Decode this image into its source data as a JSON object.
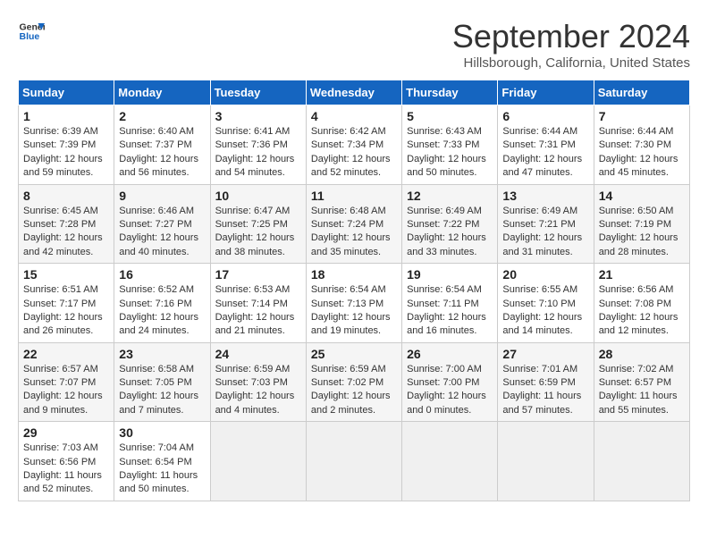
{
  "logo": {
    "line1": "General",
    "line2": "Blue"
  },
  "title": "September 2024",
  "subtitle": "Hillsborough, California, United States",
  "weekdays": [
    "Sunday",
    "Monday",
    "Tuesday",
    "Wednesday",
    "Thursday",
    "Friday",
    "Saturday"
  ],
  "weeks": [
    [
      {
        "day": "1",
        "sunrise": "6:39 AM",
        "sunset": "7:39 PM",
        "daylight": "12 hours and 59 minutes."
      },
      {
        "day": "2",
        "sunrise": "6:40 AM",
        "sunset": "7:37 PM",
        "daylight": "12 hours and 56 minutes."
      },
      {
        "day": "3",
        "sunrise": "6:41 AM",
        "sunset": "7:36 PM",
        "daylight": "12 hours and 54 minutes."
      },
      {
        "day": "4",
        "sunrise": "6:42 AM",
        "sunset": "7:34 PM",
        "daylight": "12 hours and 52 minutes."
      },
      {
        "day": "5",
        "sunrise": "6:43 AM",
        "sunset": "7:33 PM",
        "daylight": "12 hours and 50 minutes."
      },
      {
        "day": "6",
        "sunrise": "6:44 AM",
        "sunset": "7:31 PM",
        "daylight": "12 hours and 47 minutes."
      },
      {
        "day": "7",
        "sunrise": "6:44 AM",
        "sunset": "7:30 PM",
        "daylight": "12 hours and 45 minutes."
      }
    ],
    [
      {
        "day": "8",
        "sunrise": "6:45 AM",
        "sunset": "7:28 PM",
        "daylight": "12 hours and 42 minutes."
      },
      {
        "day": "9",
        "sunrise": "6:46 AM",
        "sunset": "7:27 PM",
        "daylight": "12 hours and 40 minutes."
      },
      {
        "day": "10",
        "sunrise": "6:47 AM",
        "sunset": "7:25 PM",
        "daylight": "12 hours and 38 minutes."
      },
      {
        "day": "11",
        "sunrise": "6:48 AM",
        "sunset": "7:24 PM",
        "daylight": "12 hours and 35 minutes."
      },
      {
        "day": "12",
        "sunrise": "6:49 AM",
        "sunset": "7:22 PM",
        "daylight": "12 hours and 33 minutes."
      },
      {
        "day": "13",
        "sunrise": "6:49 AM",
        "sunset": "7:21 PM",
        "daylight": "12 hours and 31 minutes."
      },
      {
        "day": "14",
        "sunrise": "6:50 AM",
        "sunset": "7:19 PM",
        "daylight": "12 hours and 28 minutes."
      }
    ],
    [
      {
        "day": "15",
        "sunrise": "6:51 AM",
        "sunset": "7:17 PM",
        "daylight": "12 hours and 26 minutes."
      },
      {
        "day": "16",
        "sunrise": "6:52 AM",
        "sunset": "7:16 PM",
        "daylight": "12 hours and 24 minutes."
      },
      {
        "day": "17",
        "sunrise": "6:53 AM",
        "sunset": "7:14 PM",
        "daylight": "12 hours and 21 minutes."
      },
      {
        "day": "18",
        "sunrise": "6:54 AM",
        "sunset": "7:13 PM",
        "daylight": "12 hours and 19 minutes."
      },
      {
        "day": "19",
        "sunrise": "6:54 AM",
        "sunset": "7:11 PM",
        "daylight": "12 hours and 16 minutes."
      },
      {
        "day": "20",
        "sunrise": "6:55 AM",
        "sunset": "7:10 PM",
        "daylight": "12 hours and 14 minutes."
      },
      {
        "day": "21",
        "sunrise": "6:56 AM",
        "sunset": "7:08 PM",
        "daylight": "12 hours and 12 minutes."
      }
    ],
    [
      {
        "day": "22",
        "sunrise": "6:57 AM",
        "sunset": "7:07 PM",
        "daylight": "12 hours and 9 minutes."
      },
      {
        "day": "23",
        "sunrise": "6:58 AM",
        "sunset": "7:05 PM",
        "daylight": "12 hours and 7 minutes."
      },
      {
        "day": "24",
        "sunrise": "6:59 AM",
        "sunset": "7:03 PM",
        "daylight": "12 hours and 4 minutes."
      },
      {
        "day": "25",
        "sunrise": "6:59 AM",
        "sunset": "7:02 PM",
        "daylight": "12 hours and 2 minutes."
      },
      {
        "day": "26",
        "sunrise": "7:00 AM",
        "sunset": "7:00 PM",
        "daylight": "12 hours and 0 minutes."
      },
      {
        "day": "27",
        "sunrise": "7:01 AM",
        "sunset": "6:59 PM",
        "daylight": "11 hours and 57 minutes."
      },
      {
        "day": "28",
        "sunrise": "7:02 AM",
        "sunset": "6:57 PM",
        "daylight": "11 hours and 55 minutes."
      }
    ],
    [
      {
        "day": "29",
        "sunrise": "7:03 AM",
        "sunset": "6:56 PM",
        "daylight": "11 hours and 52 minutes."
      },
      {
        "day": "30",
        "sunrise": "7:04 AM",
        "sunset": "6:54 PM",
        "daylight": "11 hours and 50 minutes."
      },
      null,
      null,
      null,
      null,
      null
    ]
  ]
}
